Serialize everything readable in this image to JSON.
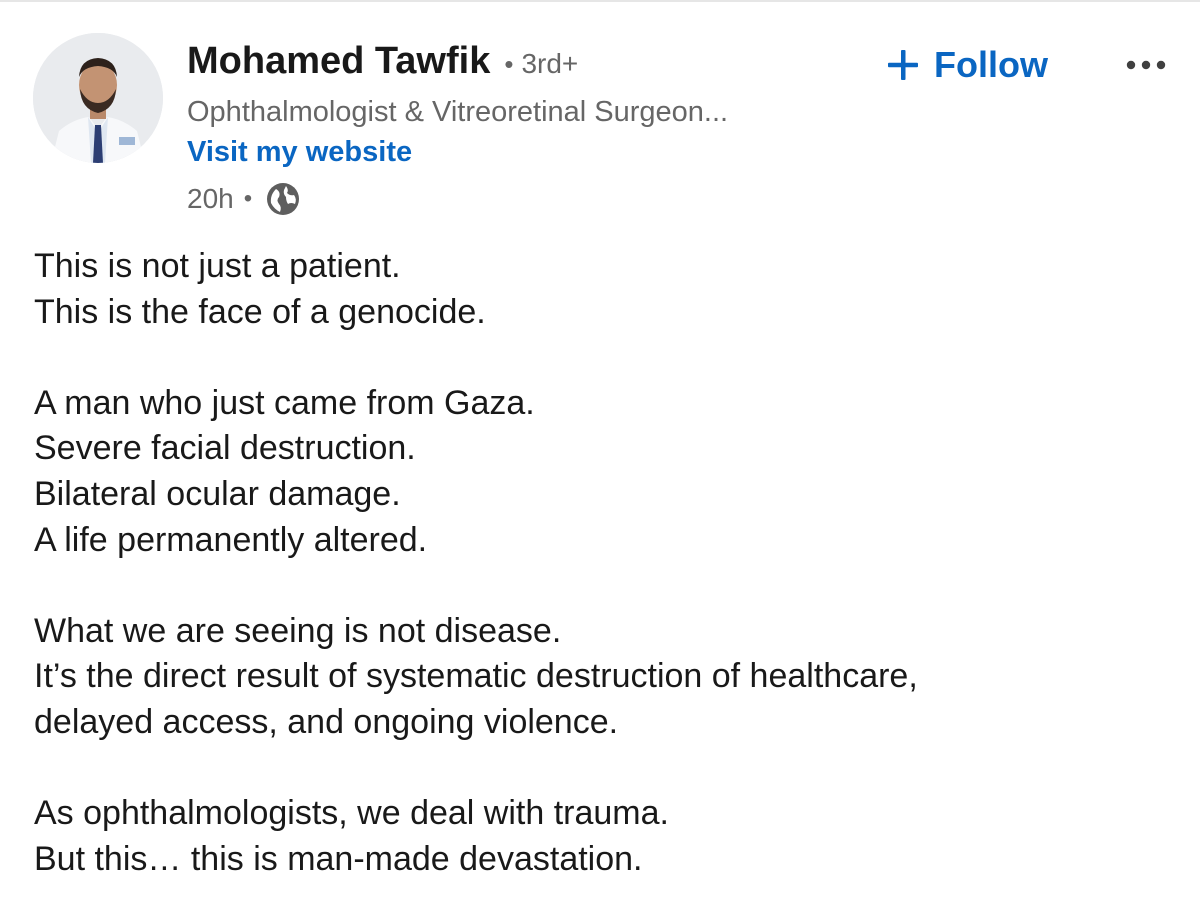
{
  "author": {
    "name": "Mohamed Tawfik",
    "connection_degree": "3rd+",
    "headline": "Ophthalmologist & Vitreoretinal Surgeon...",
    "website_link": "Visit my website",
    "avatar_icon": "profile-photo"
  },
  "post_meta": {
    "timestamp": "20h",
    "visibility_icon": "globe-icon"
  },
  "actions": {
    "follow_label": "Follow",
    "follow_icon": "plus-icon",
    "more_icon": "more-horizontal-icon"
  },
  "colors": {
    "accent": "#0a66c2",
    "text_primary": "#191919",
    "text_secondary": "#666666"
  },
  "post_body": {
    "paragraphs": [
      [
        "This is not just a patient.",
        "This is the face of a genocide."
      ],
      [
        "A man who just came from Gaza.",
        "Severe facial destruction.",
        "Bilateral ocular damage.",
        "A life permanently altered."
      ],
      [
        "What we are seeing is not disease.",
        "It’s the direct result of systematic destruction of healthcare,",
        "delayed access, and ongoing violence."
      ],
      [
        "As ophthalmologists, we deal with trauma.",
        "But this… this is man-made devastation."
      ]
    ]
  }
}
